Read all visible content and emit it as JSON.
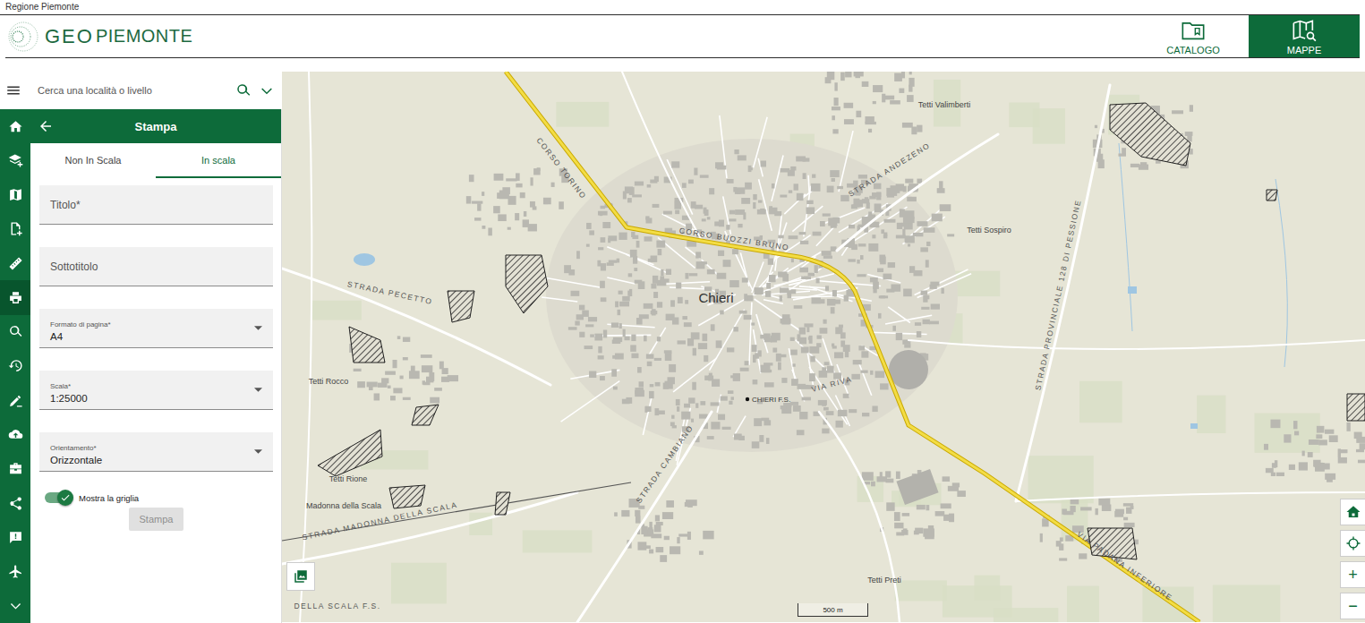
{
  "top_bar": {
    "title": "Regione Piemonte"
  },
  "header": {
    "logo_prefix": "GEO",
    "logo_name": "PIEMONTE",
    "buttons": [
      {
        "label": "CATALOGO",
        "selected": false
      },
      {
        "label": "MAPPE",
        "selected": true
      }
    ]
  },
  "search": {
    "placeholder": "Cerca una località o livello"
  },
  "nav_rail": [
    {
      "selected": false
    },
    {
      "selected": false
    },
    {
      "selected": false
    },
    {
      "selected": false
    },
    {
      "selected": false
    },
    {
      "selected": true
    },
    {
      "selected": false
    },
    {
      "selected": false
    },
    {
      "selected": false
    },
    {
      "selected": false
    },
    {
      "selected": false
    },
    {
      "selected": false
    },
    {
      "selected": false
    },
    {
      "selected": false
    },
    {
      "selected": false
    }
  ],
  "panel": {
    "title": "Stampa",
    "tabs": [
      {
        "label": "Non In Scala",
        "selected": false
      },
      {
        "label": "In scala",
        "selected": true
      }
    ],
    "fields": [
      {
        "label": "Titolo*",
        "kind": "text"
      },
      {
        "label": "Sottotitolo",
        "kind": "text"
      },
      {
        "label": "Formato di pagina*",
        "kind": "select",
        "value": "A4"
      },
      {
        "label": "Scala*",
        "kind": "select",
        "value": "1:25000"
      },
      {
        "label": "Orientamento*",
        "kind": "select",
        "value": "Orizzontale"
      }
    ],
    "toggle": {
      "label": "Mostra la griglia",
      "on": true
    },
    "button": {
      "label": "Stampa",
      "disabled": true
    }
  },
  "map": {
    "labels": [
      {
        "text": "Chieri",
        "kind": "town"
      },
      {
        "text": "Tetti Valimberti",
        "kind": "place"
      },
      {
        "text": "Tetti Sospiro",
        "kind": "place"
      },
      {
        "text": "Tetti Rocco",
        "kind": "place"
      },
      {
        "text": "Tetti Rione",
        "kind": "place"
      },
      {
        "text": "Madonna della Scala",
        "kind": "place"
      },
      {
        "text": "Tetti Preti",
        "kind": "place"
      },
      {
        "text": "CHIERI F.S.",
        "kind": "station"
      },
      {
        "text": "CORSO TORINO",
        "kind": "road"
      },
      {
        "text": "CORSO BUOZZI BRUNO",
        "kind": "road"
      },
      {
        "text": "STRADA ANDEZENO",
        "kind": "road"
      },
      {
        "text": "STRADA PECETTO",
        "kind": "road"
      },
      {
        "text": "VIA RIVA",
        "kind": "road"
      },
      {
        "text": "STRADA CAMBIANO",
        "kind": "road"
      },
      {
        "text": "VIA PADANA INFERIORE",
        "kind": "road"
      },
      {
        "text": "STRADA PROVINCIALE 128 DI PESSIONE",
        "kind": "road"
      },
      {
        "text": "STRADA MADONNA DELLA SCALA",
        "kind": "road"
      },
      {
        "text": "DELLA SCALA F.S.",
        "kind": "road"
      }
    ],
    "scale": "500 m",
    "zoom": {
      "in": "+",
      "out": "−"
    }
  }
}
